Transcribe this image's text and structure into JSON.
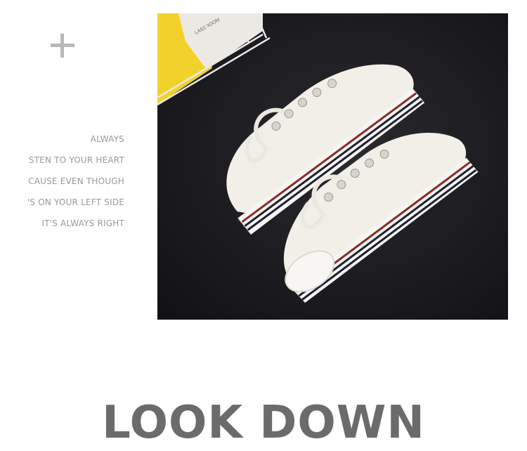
{
  "decor": {
    "plus_color": "#b9b9b9",
    "icon": "plus-icon"
  },
  "lyrics": [
    "ALWAYS",
    "STEN TO YOUR HEART",
    "CAUSE EVEN THOUGH",
    "'S ON YOUR LEFT SIDE",
    "IT'S ALWAYS RIGHT"
  ],
  "photo": {
    "subject": "white platform canvas sneakers",
    "label_text": "LASSROOM",
    "colors": {
      "background": "#1c1c20",
      "shoe": "#f2efe9",
      "stripe_red": "#8a2a25",
      "stripe_navy": "#1d2030",
      "yellow": "#f2d22a"
    }
  },
  "headline": "LOOK DOWN"
}
